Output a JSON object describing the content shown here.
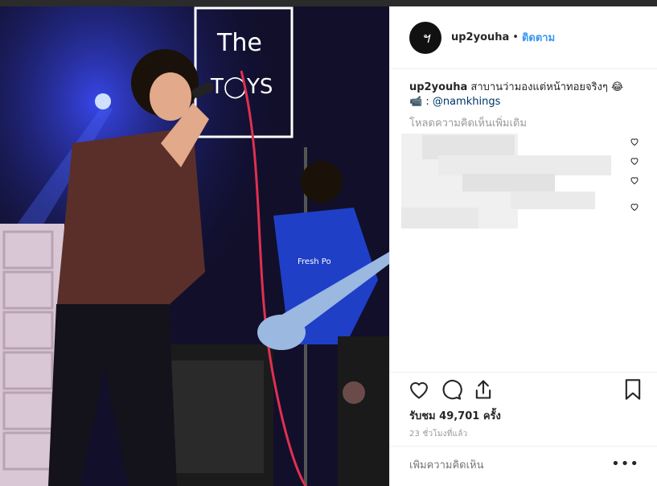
{
  "post": {
    "username": "up2youha",
    "dot": "•",
    "follow_label": "ติดตาม",
    "avatar_glyph": "ฯ",
    "caption_text": " สาบานว่ามองแต่หน้าทอยจริงๆ 😂",
    "credit_prefix": "📹 : ",
    "credit_mention": "@namkhings",
    "load_more_comments": "โหลดความคิดเห็นเพิ่มเติม",
    "views_label": "รับชม 49,701 ครั้ง",
    "timestamp": "23 ชั่วโมงที่แล้ว",
    "comment_placeholder": "เพิ่มความคิดเห็น",
    "more_options": "•••"
  },
  "video": {
    "sign_text_line1": "The",
    "sign_text_line2": "T◯YS",
    "amp_brand": "Fresh Po"
  },
  "icons": {
    "like": "heart-icon",
    "comment": "comment-icon",
    "share": "share-icon",
    "save": "bookmark-icon"
  },
  "colors": {
    "link_blue": "#3897f0",
    "mention_blue": "#003569",
    "muted_gray": "#999999",
    "border": "#efefef"
  }
}
